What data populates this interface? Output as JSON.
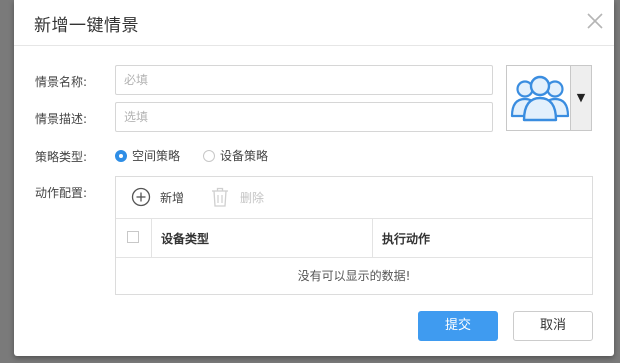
{
  "dialog": {
    "title": "新增一键情景",
    "close_icon": "close-icon"
  },
  "form": {
    "name_label": "情景名称:",
    "name_placeholder": "必填",
    "name_value": "",
    "desc_label": "情景描述:",
    "desc_placeholder": "选填",
    "desc_value": "",
    "strategy_label": "策略类型:",
    "strategy_options": [
      {
        "label": "空间策略",
        "selected": true
      },
      {
        "label": "设备策略",
        "selected": false
      }
    ],
    "action_label": "动作配置:"
  },
  "avatar": {
    "icon": "user-group-icon",
    "dropdown_icon": "▼"
  },
  "actions_table": {
    "add_label": "新增",
    "delete_label": "删除",
    "columns": [
      "设备类型",
      "执行动作"
    ],
    "empty_text": "没有可以显示的数据!"
  },
  "footer": {
    "submit_label": "提交",
    "cancel_label": "取消"
  },
  "colors": {
    "accent": "#3f9bf0",
    "avatar_stroke": "#3a8de0",
    "avatar_fill": "#e3f0fc"
  }
}
